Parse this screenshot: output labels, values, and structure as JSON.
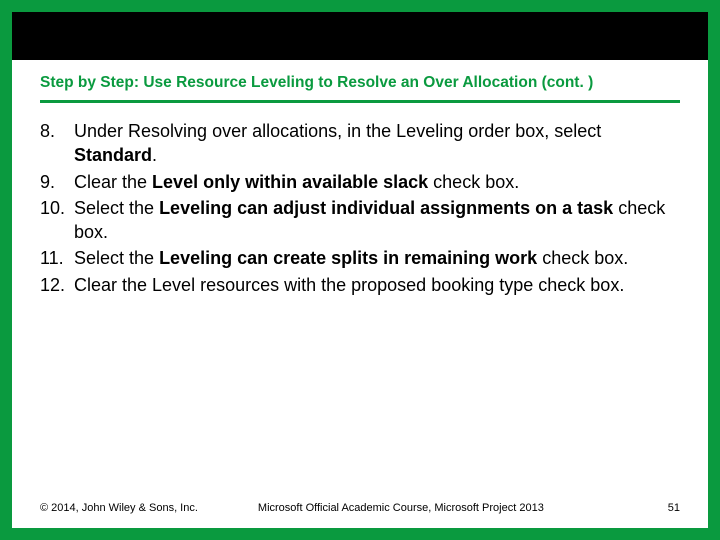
{
  "title": "Step by Step: Use Resource Leveling to Resolve an Over Allocation (cont. )",
  "steps": [
    {
      "num": "8.",
      "pre": "Under Resolving over allocations, in the Leveling order box, select ",
      "b1": "Standard",
      "post": "."
    },
    {
      "num": "9.",
      "pre": "Clear the ",
      "b1": "Level only within available slack",
      "post": " check box."
    },
    {
      "num": "10.",
      "pre": "Select the ",
      "b1": "Leveling can adjust individual assignments on a task",
      "post": " check box."
    },
    {
      "num": "11.",
      "pre": "Select the ",
      "b1": "Leveling can create splits in remaining work",
      "post": " check box."
    },
    {
      "num": "12.",
      "pre": "Clear the Level resources with the proposed booking type check box.",
      "b1": "",
      "post": ""
    }
  ],
  "footer": {
    "copyright": "© 2014, John Wiley & Sons, Inc.",
    "course": "Microsoft Official Academic Course, Microsoft Project 2013",
    "page": "51"
  }
}
